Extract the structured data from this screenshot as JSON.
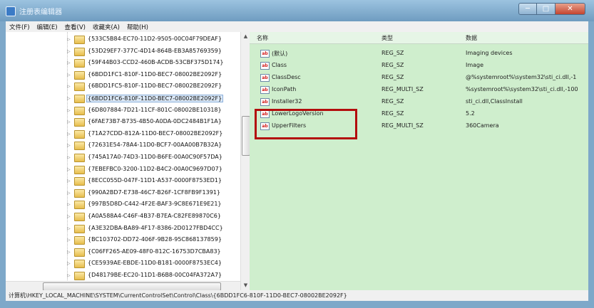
{
  "window": {
    "title": "注册表编辑器",
    "minimize": "─",
    "maximize": "□",
    "close": "✕"
  },
  "menu": [
    "文件(F)",
    "编辑(E)",
    "查看(V)",
    "收藏夹(A)",
    "帮助(H)"
  ],
  "tree": {
    "keys": [
      "{533C5B84-EC70-11D2-9505-00C04F79DEAF}",
      "{53D29EF7-377C-4D14-864B-EB3A85769359}",
      "{59F44B03-CCD2-460B-ACDB-53CBF375D174}",
      "{6BDD1FC1-810F-11D0-BEC7-08002BE2092F}",
      "{6BDD1FC5-810F-11D0-BEC7-08002BE2092F}",
      "{6BDD1FC6-810F-11D0-BEC7-08002BE2092F}",
      "{6D807884-7D21-11CF-801C-08002BE10318}",
      "{6FAE73B7-B735-4B50-A0DA-0DC2484B1F1A}",
      "{71A27CDD-812A-11D0-BEC7-08002BE2092F}",
      "{72631E54-78A4-11D0-BCF7-00AA00B7B32A}",
      "{745A17A0-74D3-11D0-B6FE-00A0C90F57DA}",
      "{7EBEFBC0-3200-11D2-B4C2-00A0C9697D07}",
      "{8ECC055D-047F-11D1-A537-0000F8753ED1}",
      "{990A2BD7-E738-46C7-B26F-1CF8FB9F1391}",
      "{997B5D8D-C442-4F2E-BAF3-9C8E671E9E21}",
      "{A0A588A4-C46F-4B37-B7EA-C82FE89870C6}",
      "{A3E32DBA-BA89-4F17-8386-2D0127FBD4CC}",
      "{BC103702-DD72-406F-9B28-95C868137859}",
      "{C06FF265-AE09-48F0-812C-16753D7CBA83}",
      "{CE5939AE-EBDE-11D0-B181-0000F8753EC4}",
      "{D48179BE-EC20-11D1-B6B8-00C04FA372A7}"
    ],
    "selected_index": 5
  },
  "values": {
    "columns": {
      "name": "名称",
      "type": "类型",
      "data": "数据"
    },
    "icon_label": "ab",
    "rows": [
      {
        "name": "(默认)",
        "type": "REG_SZ",
        "data": "Imaging devices"
      },
      {
        "name": "Class",
        "type": "REG_SZ",
        "data": "Image"
      },
      {
        "name": "ClassDesc",
        "type": "REG_SZ",
        "data": "@%systemroot%\\system32\\sti_ci.dll,-1"
      },
      {
        "name": "IconPath",
        "type": "REG_MULTI_SZ",
        "data": "%systemroot%\\system32\\sti_ci.dll,-100"
      },
      {
        "name": "Installer32",
        "type": "REG_SZ",
        "data": "sti_ci.dll,ClassInstall"
      },
      {
        "name": "LowerLogoVersion",
        "type": "REG_SZ",
        "data": "5.2"
      },
      {
        "name": "UpperFilters",
        "type": "REG_MULTI_SZ",
        "data": "360Camera"
      }
    ]
  },
  "status": {
    "path": "计算机\\HKEY_LOCAL_MACHINE\\SYSTEM\\CurrentControlSet\\Control\\Class\\{6BDD1FC6-810F-11D0-BEC7-08002BE2092F}"
  },
  "colors": {
    "highlight_box": "#b30d0d",
    "values_background": "#cfeecd",
    "titlebar": "#7ea8c9"
  }
}
